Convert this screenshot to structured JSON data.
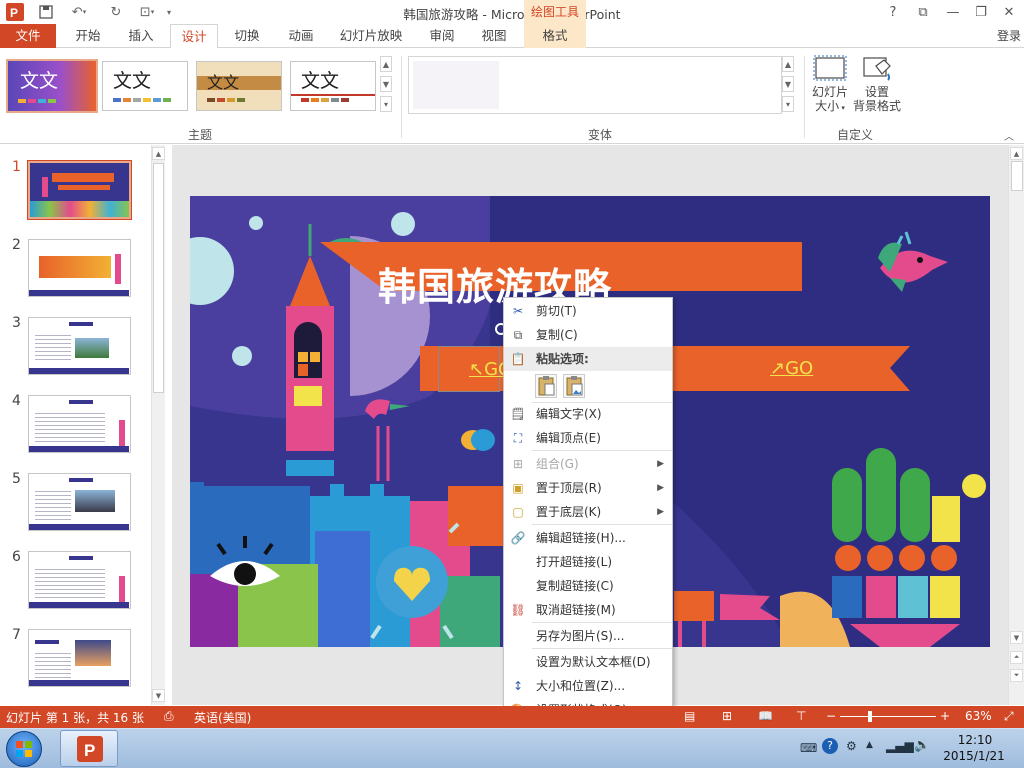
{
  "app": {
    "window_title": "韩国旅游攻略 - Microsoft PowerPoint",
    "contextual_tools": "绘图工具",
    "login": "登录",
    "help": "?"
  },
  "tabs": [
    "文件",
    "开始",
    "插入",
    "设计",
    "切换",
    "动画",
    "幻灯片放映",
    "审阅",
    "视图",
    "格式"
  ],
  "ribbon": {
    "themes_group": "主题",
    "variants_group": "变体",
    "customize_group": "自定义",
    "theme_sample": "文文",
    "slide_size": "幻灯片",
    "slide_size2": "大小",
    "bg_format": "设置",
    "bg_format2": "背景格式"
  },
  "slide_numbers": [
    "1",
    "2",
    "3",
    "4",
    "5",
    "6",
    "7"
  ],
  "slide": {
    "title": "韩国旅游攻略",
    "go_left": "↖GO",
    "go_right": "↗GO"
  },
  "context_menu": {
    "cut": "剪切(T)",
    "copy": "复制(C)",
    "paste_options": "粘贴选项:",
    "edit_text": "编辑文字(X)",
    "edit_points": "编辑顶点(E)",
    "group": "组合(G)",
    "bring_front": "置于顶层(R)",
    "send_back": "置于底层(K)",
    "edit_link": "编辑超链接(H)...",
    "open_link": "打开超链接(L)",
    "copy_link": "复制超链接(C)",
    "remove_link": "取消超链接(M)",
    "save_pic": "另存为图片(S)...",
    "set_default": "设置为默认文本框(D)",
    "size_pos": "大小和位置(Z)...",
    "format_shape": "设置形状格式(O)..."
  },
  "status": {
    "slide_info": "幻灯片 第 1 张，共 16 张",
    "language": "英语(美国)",
    "zoom": "63%"
  },
  "taskbar": {
    "time": "12:10",
    "date": "2015/1/21"
  },
  "colors": {
    "accent": "#d24726",
    "slide_bg": "#37358e",
    "ribbon_orange": "#e8622a"
  }
}
